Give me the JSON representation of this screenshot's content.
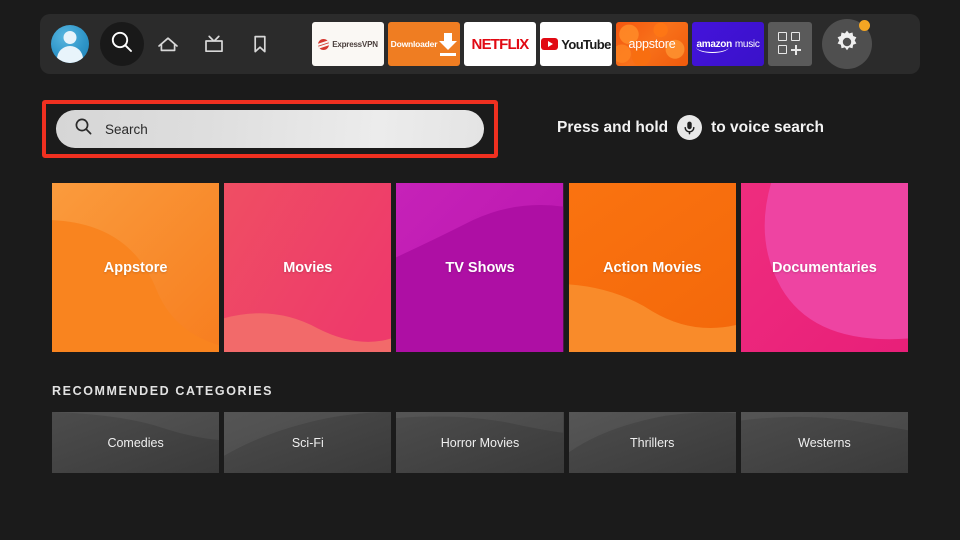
{
  "nav": {
    "avatar_name": "profile-avatar",
    "items": [
      {
        "name": "search",
        "icon": "search-icon",
        "selected": true
      },
      {
        "name": "home",
        "icon": "home-icon",
        "selected": false
      },
      {
        "name": "live",
        "icon": "tv-icon",
        "selected": false
      },
      {
        "name": "watchlist",
        "icon": "bookmark-icon",
        "selected": false
      }
    ],
    "apps": [
      {
        "id": "expressvpn",
        "label": "ExpressVPN"
      },
      {
        "id": "downloader",
        "label": "Downloader"
      },
      {
        "id": "netflix",
        "label": "NETFLIX"
      },
      {
        "id": "youtube",
        "label": "YouTube"
      },
      {
        "id": "appstore",
        "label": "appstore"
      },
      {
        "id": "amazonmusic",
        "label_bold": "amazon",
        "label_light": "music"
      }
    ],
    "apps_grid_label": "apps-grid",
    "settings_label": "settings",
    "settings_has_badge": true
  },
  "search": {
    "placeholder": "Search",
    "highlighted": true,
    "highlight_color": "#f03020",
    "voice_hint_before": "Press and hold",
    "voice_hint_after": "to voice search"
  },
  "tiles": [
    {
      "label": "Appstore",
      "c1": "#fa9b3d",
      "c2": "#f77e1f",
      "blob": "#f9841f",
      "blob2": "#fb9a3a"
    },
    {
      "label": "Movies",
      "c1": "#ef4e63",
      "c2": "#ee3a6b",
      "blob": "#f26a6a",
      "blob2": "#f15c5f"
    },
    {
      "label": "TV Shows",
      "c1": "#c622b8",
      "c2": "#b814ae",
      "blob": "#ae0fa4",
      "blob2": "#c41fb6"
    },
    {
      "label": "Action Movies",
      "c1": "#fa7310",
      "c2": "#f4690b",
      "blob": "#f98b2a",
      "blob2": "#fb8020"
    },
    {
      "label": "Documentaries",
      "c1": "#ef2d7e",
      "c2": "#e81f79",
      "blob": "#ee44a2",
      "blob2": "#f03894"
    }
  ],
  "recommended": {
    "title": "RECOMMENDED CATEGORIES",
    "tiles": [
      {
        "label": "Comedies"
      },
      {
        "label": "Sci-Fi"
      },
      {
        "label": "Horror Movies"
      },
      {
        "label": "Thrillers"
      },
      {
        "label": "Westerns"
      }
    ]
  },
  "theme": {
    "background": "#1b1b1b",
    "navbar_background": "#2b2b2b",
    "accent_highlight": "#f03020",
    "badge_color": "#f5a623"
  }
}
